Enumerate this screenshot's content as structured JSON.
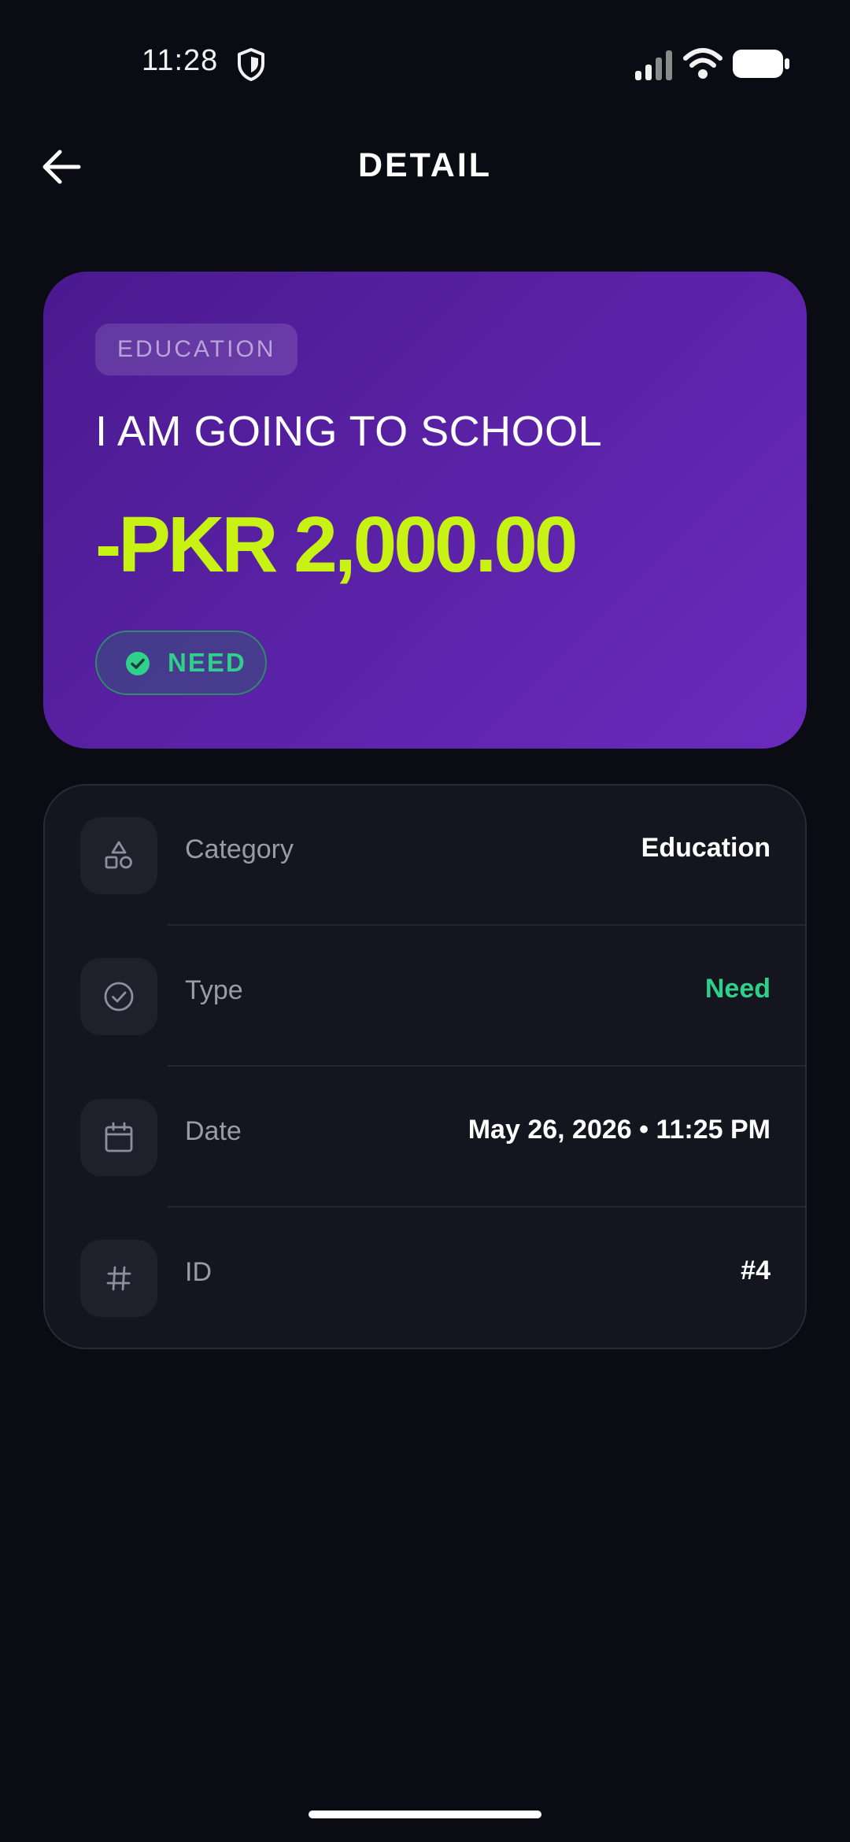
{
  "status_bar": {
    "time": "11:28"
  },
  "header": {
    "title": "DETAIL"
  },
  "hero": {
    "tag": "EDUCATION",
    "title": "I AM GOING TO SCHOOL",
    "amount": "-PKR 2,000.00",
    "badge": "NEED",
    "colors": {
      "amount": "#c8f214",
      "badge": "#2fd08a",
      "card_start": "#4a1a8f",
      "card_end": "#6a2bbe"
    }
  },
  "details": {
    "rows": [
      {
        "icon": "shapes-icon",
        "label": "Category",
        "value": "Education"
      },
      {
        "icon": "check-circle-icon",
        "label": "Type",
        "value": "Need"
      },
      {
        "icon": "calendar-icon",
        "label": "Date",
        "value": "May 26, 2026 • 11:25 PM"
      },
      {
        "icon": "hash-icon",
        "label": "ID",
        "value": "#4"
      }
    ]
  }
}
